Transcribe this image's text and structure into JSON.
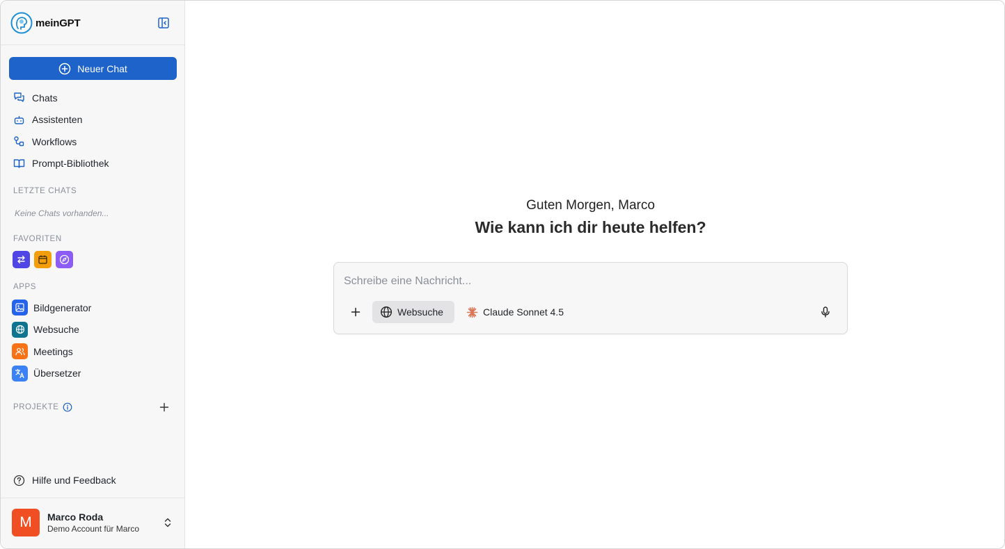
{
  "brand": {
    "name": "meinGPT"
  },
  "sidebar": {
    "new_chat_label": "Neuer Chat",
    "nav": [
      {
        "label": "Chats",
        "icon": "chats-icon"
      },
      {
        "label": "Assistenten",
        "icon": "robot-icon"
      },
      {
        "label": "Workflows",
        "icon": "workflow-icon"
      },
      {
        "label": "Prompt-Bibliothek",
        "icon": "book-open-icon"
      }
    ],
    "recent_label": "LETZTE CHATS",
    "recent_empty": "Keine Chats vorhanden...",
    "favorites_label": "FAVORITEN",
    "favorites": [
      {
        "icon": "arrows-exchange-icon",
        "color": "#4f46e5"
      },
      {
        "icon": "calendar-icon",
        "color": "#f59e0b"
      },
      {
        "icon": "compass-icon",
        "color": "#8b5cf6"
      }
    ],
    "apps_label": "APPS",
    "apps": [
      {
        "label": "Bildgenerator",
        "icon": "image-icon",
        "color": "#2563eb"
      },
      {
        "label": "Websuche",
        "icon": "globe-icon",
        "color": "#0e7490"
      },
      {
        "label": "Meetings",
        "icon": "users-icon",
        "color": "#f97316"
      },
      {
        "label": "Übersetzer",
        "icon": "translate-icon",
        "color": "#3b82f6"
      }
    ],
    "projects_label": "PROJEKTE",
    "help_label": "Hilfe und Feedback",
    "user": {
      "initial": "M",
      "name": "Marco Roda",
      "subtitle": "Demo Account für Marco"
    }
  },
  "main": {
    "greeting": "Guten Morgen, Marco",
    "headline": "Wie kann ich dir heute helfen?",
    "composer": {
      "placeholder": "Schreibe eine Nachricht...",
      "websearch_label": "Websuche",
      "model_label": "Claude Sonnet 4.5"
    }
  },
  "colors": {
    "accent": "#1e63c9",
    "avatar": "#f04e23",
    "claude": "#d97757"
  }
}
